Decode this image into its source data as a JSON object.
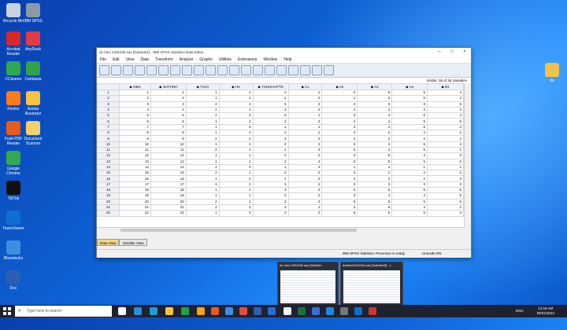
{
  "desktop": {
    "icons": [
      {
        "label": "Recycle Bin",
        "color": "#c8d3df"
      },
      {
        "label": "Acrobat Reader",
        "color": "#d62828"
      },
      {
        "label": "CCleaner",
        "color": "#2fa84f"
      },
      {
        "label": "Firefox",
        "color": "#ff7a1a"
      },
      {
        "label": "Foxit PDF Reader",
        "color": "#e85b1a"
      },
      {
        "label": "Google Chrome",
        "color": "#34a853"
      },
      {
        "label": "TikTok",
        "color": "#111111"
      },
      {
        "label": "TeamViewer",
        "color": "#0e6fd1"
      },
      {
        "label": "Bluestacks",
        "color": "#3b8fe0"
      },
      {
        "label": "Doc",
        "color": "#2b5fb3"
      }
    ],
    "icons_col2": [
      {
        "label": "IBM SPSS",
        "color": "#8d99a6"
      },
      {
        "label": "AnyDesk",
        "color": "#e63946"
      },
      {
        "label": "Camtasia",
        "color": "#31a14a"
      },
      {
        "label": "Adobe Illustrator",
        "color": "#f5c242"
      },
      {
        "label": "Document Scanner",
        "color": "#f2d16b"
      }
    ],
    "right_icon": {
      "label": "do",
      "color": "#f2c14e"
    }
  },
  "window": {
    "title": "do hieu 240123b.sav [DataSet1] - IBM SPSS Statistics Data Editor",
    "menu": [
      "File",
      "Edit",
      "View",
      "Data",
      "Transform",
      "Analyze",
      "Graphs",
      "Utilities",
      "Extensions",
      "Window",
      "Help"
    ],
    "visible_label": "Visible: 38 of 38 Variables",
    "columns": [
      "OBS",
      "GIOTINH",
      "TUOI",
      "HV",
      "THUNHAPTD",
      "A1",
      "A2",
      "A3",
      "A4",
      "B1"
    ],
    "rows": [
      [
        "1",
        "1",
        "1",
        "2",
        "2",
        "1",
        "2",
        "5",
        "5",
        "4"
      ],
      [
        "2",
        "2",
        "1",
        "2",
        "2",
        "2",
        "1",
        "5",
        "5",
        "4"
      ],
      [
        "3",
        "3",
        "2",
        "2",
        "3",
        "3",
        "2",
        "5",
        "3",
        "5"
      ],
      [
        "4",
        "4",
        "1",
        "1",
        "3",
        "2",
        "4",
        "4",
        "4",
        "4"
      ],
      [
        "5",
        "5",
        "2",
        "2",
        "3",
        "1",
        "3",
        "4",
        "5",
        "4"
      ],
      [
        "6",
        "6",
        "1",
        "2",
        "2",
        "2",
        "4",
        "4",
        "5",
        "5"
      ],
      [
        "7",
        "7",
        "1",
        "3",
        "1",
        "1",
        "4",
        "4",
        "5",
        "4"
      ],
      [
        "8",
        "8",
        "1",
        "3",
        "2",
        "1",
        "2",
        "2",
        "4",
        "2"
      ],
      [
        "9",
        "9",
        "2",
        "2",
        "3",
        "3",
        "2",
        "2",
        "4",
        "2"
      ],
      [
        "10",
        "10",
        "1",
        "2",
        "2",
        "2",
        "5",
        "4",
        "5",
        "4"
      ],
      [
        "11",
        "11",
        "2",
        "1",
        "1",
        "3",
        "5",
        "4",
        "5",
        "1"
      ],
      [
        "12",
        "12",
        "1",
        "1",
        "2",
        "2",
        "3",
        "5",
        "4",
        "3"
      ],
      [
        "13",
        "13",
        "1",
        "1",
        "2",
        "4",
        "3",
        "5",
        "5",
        "5"
      ],
      [
        "14",
        "14",
        "2",
        "3",
        "1",
        "3",
        "1",
        "4",
        "1",
        "1"
      ],
      [
        "15",
        "15",
        "2",
        "1",
        "3",
        "4",
        "2",
        "2",
        "2",
        "2"
      ],
      [
        "16",
        "16",
        "1",
        "2",
        "2",
        "3",
        "2",
        "2",
        "2",
        "3"
      ],
      [
        "17",
        "17",
        "1",
        "2",
        "3",
        "2",
        "3",
        "3",
        "3",
        "3"
      ],
      [
        "18",
        "18",
        "1",
        "1",
        "3",
        "2",
        "5",
        "5",
        "5",
        "5"
      ],
      [
        "19",
        "19",
        "1",
        "1",
        "3",
        "2",
        "3",
        "4",
        "4",
        "5"
      ],
      [
        "20",
        "20",
        "2",
        "1",
        "2",
        "3",
        "5",
        "5",
        "5",
        "5"
      ],
      [
        "21",
        "21",
        "2",
        "3",
        "3",
        "1",
        "3",
        "5",
        "4",
        "2"
      ],
      [
        "22",
        "22",
        "1",
        "3",
        "3",
        "2",
        "5",
        "5",
        "5",
        "4"
      ]
    ],
    "tabs": [
      "Data View",
      "Variable View"
    ],
    "status_processor": "IBM SPSS Statistics Processor is ready",
    "status_unicode": "Unicode:ON"
  },
  "taskbar": {
    "search_placeholder": "Type here to search",
    "lang": "ENG",
    "time": "12:18 AM",
    "date": "25/01/2024",
    "previews": [
      {
        "title": "do hieu 240123b.sav [DataSe..."
      },
      {
        "title": "duthieu240123b.sav [DataSet3] - I..."
      }
    ]
  }
}
